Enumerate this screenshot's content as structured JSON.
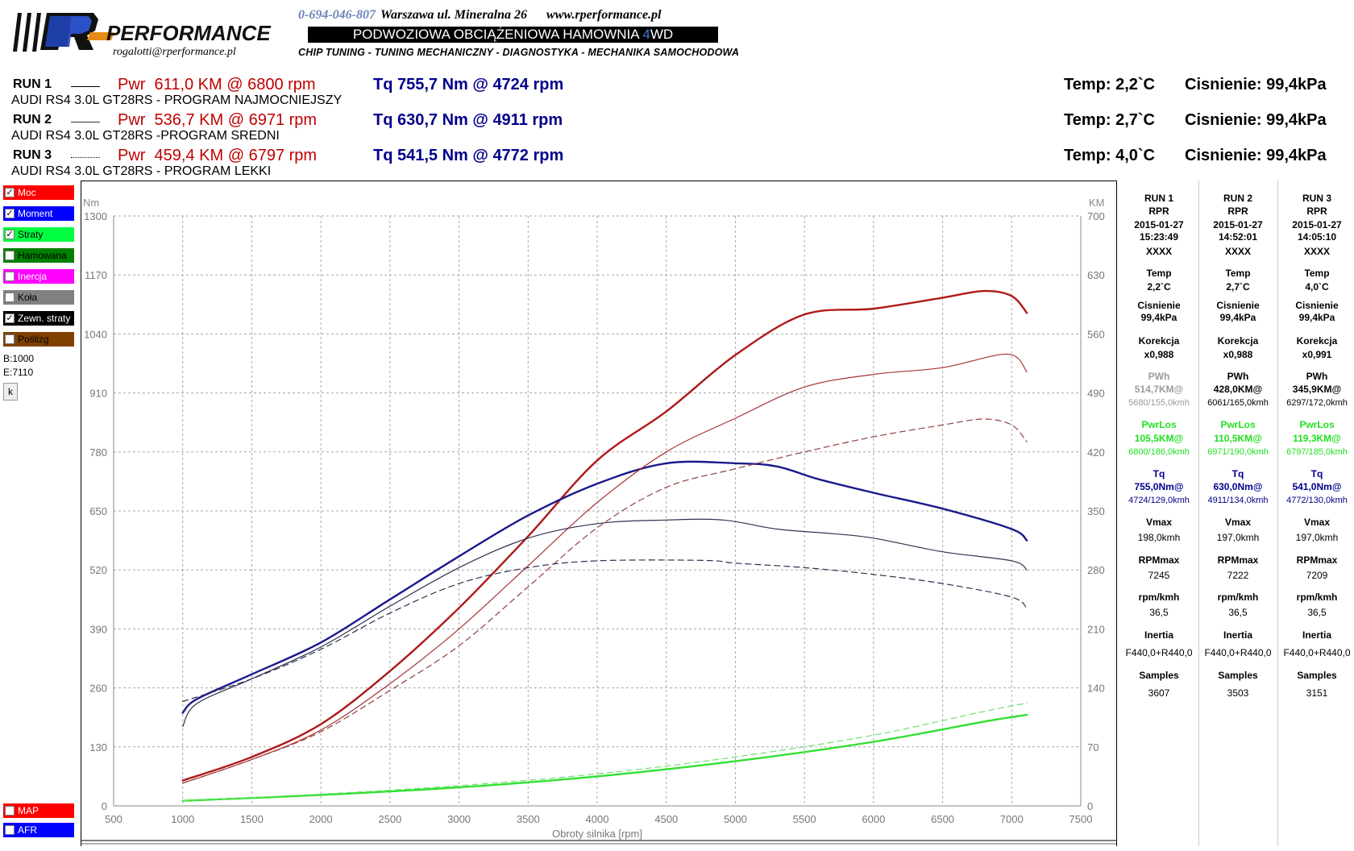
{
  "header": {
    "brand": "PERFORMANCE",
    "email": "rogalotti@rperformance.pl",
    "phone": "0-694-046-807",
    "address": "Warszawa ul. Mineralna 26",
    "website": "www.rperformance.pl",
    "banner_pre": "PODWOZIOWA OBCIĄŻENIOWA HAMOWNIA ",
    "banner_4": "4",
    "banner_wd": "WD",
    "tagline": "CHIP TUNING - TUNING MECHANICZNY - DIAGNOSTYKA - MECHANIKA SAMOCHODOWA"
  },
  "runs": [
    {
      "name": "RUN 1",
      "power": "Pwr  611,0 KM @ 6800 rpm",
      "torque": "Tq 755,7 Nm @ 4724 rpm",
      "temp": "Temp: 2,2`C",
      "pressure": "Cisnienie: 99,4kPa",
      "car": "AUDI RS4 3.0L GT28RS - PROGRAM NAJMOCNIEJSZY",
      "line_style": "solid-thick"
    },
    {
      "name": "RUN 2",
      "power": "Pwr  536,7 KM @ 6971 rpm",
      "torque": "Tq 630,7 Nm @ 4911 rpm",
      "temp": "Temp: 2,7`C",
      "pressure": "Cisnienie: 99,4kPa",
      "car": "AUDI RS4 3.0L GT28RS -PROGRAM SREDNI",
      "line_style": "solid-thin"
    },
    {
      "name": "RUN 3",
      "power": "Pwr  459,4 KM @ 6797 rpm",
      "torque": "Tq 541,5 Nm @ 4772 rpm",
      "temp": "Temp: 4,0`C",
      "pressure": "Cisnienie: 99,4kPa",
      "car": "AUDI RS4 3.0L GT28RS - PROGRAM LEKKI",
      "line_style": "dotted"
    }
  ],
  "legend": [
    {
      "label": "Moc",
      "checked": true,
      "color": "#ff0000"
    },
    {
      "label": "Moment",
      "checked": true,
      "color": "#0000ff"
    },
    {
      "label": "Straty",
      "checked": true,
      "color": "#00ff40"
    },
    {
      "label": "Hamowana",
      "checked": false,
      "color": "#008000"
    },
    {
      "label": "Inercja",
      "checked": false,
      "color": "#ff00ff"
    },
    {
      "label": "Koła",
      "checked": false,
      "color": "#808080"
    },
    {
      "label": "Zewn. straty",
      "checked": true,
      "color": "#000000"
    },
    {
      "label": "Poślizg",
      "checked": false,
      "color": "#804000"
    }
  ],
  "legend_bottom": [
    {
      "label": "MAP",
      "checked": false,
      "color": "#ff0000"
    },
    {
      "label": "AFR",
      "checked": false,
      "color": "#0000ff"
    }
  ],
  "range": {
    "begin": "B:1000",
    "end": "E:7110"
  },
  "k_button": "k",
  "table": {
    "labels": {
      "temp": "Temp",
      "pressure": "Cisnienie",
      "correction": "Korekcja",
      "pwh": "PWh",
      "pwrlos": "PwrLos",
      "tq": "Tq",
      "vmax": "Vmax",
      "rpmmax": "RPMmax",
      "rpmkmh": "rpm/kmh",
      "inertia": "Inertia",
      "samples": "Samples"
    },
    "columns": [
      {
        "run": "RUN 1",
        "code": "RPR",
        "date": "2015-01-27",
        "time": "15:23:49",
        "id": "XXXX",
        "temp": "2,2`C",
        "pressure": "99,4kPa",
        "correction": "x0,988",
        "pwh_val": "514,7KM@",
        "pwh_at": "5680/155,0kmh",
        "pwrlos_val": "105,5KM@",
        "pwrlos_at": "6800/186,0kmh",
        "tq_val": "755,0Nm@",
        "tq_at": "4724/129,0kmh",
        "vmax": "198,0kmh",
        "rpmmax": "7245",
        "rpmkmh": "36,5",
        "inertia": "F440,0+R440,0",
        "samples": "3607"
      },
      {
        "run": "RUN 2",
        "code": "RPR",
        "date": "2015-01-27",
        "time": "14:52:01",
        "id": "XXXX",
        "temp": "2,7`C",
        "pressure": "99,4kPa",
        "correction": "x0,988",
        "pwh_val": "428,0KM@",
        "pwh_at": "6061/165,0kmh",
        "pwrlos_val": "110,5KM@",
        "pwrlos_at": "6971/190,0kmh",
        "tq_val": "630,0Nm@",
        "tq_at": "4911/134,0kmh",
        "vmax": "197,0kmh",
        "rpmmax": "7222",
        "rpmkmh": "36,5",
        "inertia": "F440,0+R440,0",
        "samples": "3503"
      },
      {
        "run": "RUN 3",
        "code": "RPR",
        "date": "2015-01-27",
        "time": "14:05:10",
        "id": "XXXX",
        "temp": "4,0`C",
        "pressure": "99,4kPa",
        "correction": "x0,991",
        "pwh_val": "345,9KM@",
        "pwh_at": "6297/172,0kmh",
        "pwrlos_val": "119,3KM@",
        "pwrlos_at": "6797/185,0kmh",
        "tq_val": "541,0Nm@",
        "tq_at": "4772/130,0kmh",
        "vmax": "197,0kmh",
        "rpmmax": "7209",
        "rpmkmh": "36,5",
        "inertia": "F440,0+R440,0",
        "samples": "3151"
      }
    ]
  },
  "chart_data": {
    "type": "line",
    "xlabel": "Obroty silnika [rpm]",
    "y_left_unit": "Nm",
    "y_right_unit": "KM",
    "xlim": [
      500,
      7500
    ],
    "x_ticks": [
      500,
      1000,
      1500,
      2000,
      2500,
      3000,
      3500,
      4000,
      4500,
      5000,
      5500,
      6000,
      6500,
      7000,
      7500
    ],
    "y_left_lim": [
      0,
      1300
    ],
    "y_left_ticks": [
      0,
      130,
      260,
      390,
      520,
      650,
      780,
      910,
      1040,
      1170,
      1300
    ],
    "y_right_lim": [
      0,
      700
    ],
    "y_right_ticks": [
      0,
      70,
      140,
      210,
      280,
      350,
      420,
      490,
      560,
      630,
      700
    ],
    "grid": true,
    "series": [
      {
        "name": "Run 1 Moc",
        "axis": "right",
        "color": "#b01818",
        "style": "solid-thick",
        "x": [
          1000,
          1500,
          2000,
          2500,
          3000,
          3500,
          4000,
          4500,
          5000,
          5500,
          6000,
          6500,
          6800,
          7000,
          7110
        ],
        "y": [
          30,
          58,
          97,
          160,
          235,
          320,
          410,
          468,
          535,
          583,
          590,
          603,
          611,
          605,
          585
        ]
      },
      {
        "name": "Run 1 Moment",
        "axis": "left",
        "color": "#1a1a8c",
        "style": "solid-thick",
        "x": [
          1000,
          1100,
          1500,
          2000,
          2500,
          3000,
          3500,
          4000,
          4500,
          5000,
          5300,
          5600,
          6000,
          6500,
          7000,
          7110
        ],
        "y": [
          205,
          235,
          290,
          360,
          455,
          550,
          640,
          710,
          755,
          755,
          748,
          720,
          690,
          655,
          610,
          585
        ]
      },
      {
        "name": "Run 2 Moc",
        "axis": "right",
        "color": "#a83434",
        "style": "solid-thin",
        "x": [
          1000,
          1500,
          2000,
          2500,
          3000,
          3500,
          4000,
          4500,
          5000,
          5500,
          6000,
          6500,
          6971,
          7110
        ],
        "y": [
          27,
          55,
          90,
          145,
          210,
          285,
          360,
          420,
          460,
          497,
          512,
          520,
          536,
          515
        ]
      },
      {
        "name": "Run 2 Moment",
        "axis": "left",
        "color": "#303050",
        "style": "solid-thin",
        "x": [
          1000,
          1100,
          1500,
          2000,
          2500,
          3000,
          3500,
          4000,
          4500,
          4911,
          5300,
          5700,
          6000,
          6500,
          7000,
          7110
        ],
        "y": [
          175,
          225,
          280,
          350,
          440,
          525,
          590,
          622,
          630,
          630,
          610,
          600,
          590,
          560,
          540,
          520
        ]
      },
      {
        "name": "Run 3 Moc",
        "axis": "right",
        "color": "#904040",
        "style": "dashed",
        "x": [
          1000,
          1500,
          2000,
          2500,
          3000,
          3500,
          4000,
          4500,
          5000,
          5500,
          6000,
          6500,
          6797,
          7000,
          7110
        ],
        "y": [
          27,
          55,
          88,
          137,
          190,
          260,
          330,
          378,
          400,
          420,
          438,
          452,
          459,
          452,
          432
        ]
      },
      {
        "name": "Run 3 Moment",
        "axis": "left",
        "color": "#303050",
        "style": "dashed",
        "x": [
          1000,
          1500,
          2000,
          2500,
          3000,
          3500,
          4000,
          4772,
          5000,
          5500,
          6000,
          6500,
          7000,
          7110
        ],
        "y": [
          230,
          280,
          345,
          425,
          490,
          525,
          540,
          541,
          535,
          525,
          510,
          490,
          460,
          435
        ]
      },
      {
        "name": "Run 1 Straty",
        "axis": "right",
        "color": "#30e030",
        "style": "solid-thick",
        "x": [
          1000,
          2000,
          3000,
          4000,
          5000,
          6000,
          6800,
          7110
        ],
        "y": [
          6,
          13,
          22,
          35,
          53,
          76,
          100,
          108
        ]
      },
      {
        "name": "Run 3 Straty",
        "axis": "right",
        "color": "#70e070",
        "style": "dashed",
        "x": [
          1000,
          2000,
          3000,
          4000,
          5000,
          6000,
          6797,
          7110
        ],
        "y": [
          6,
          14,
          24,
          38,
          58,
          84,
          112,
          122
        ]
      }
    ]
  }
}
